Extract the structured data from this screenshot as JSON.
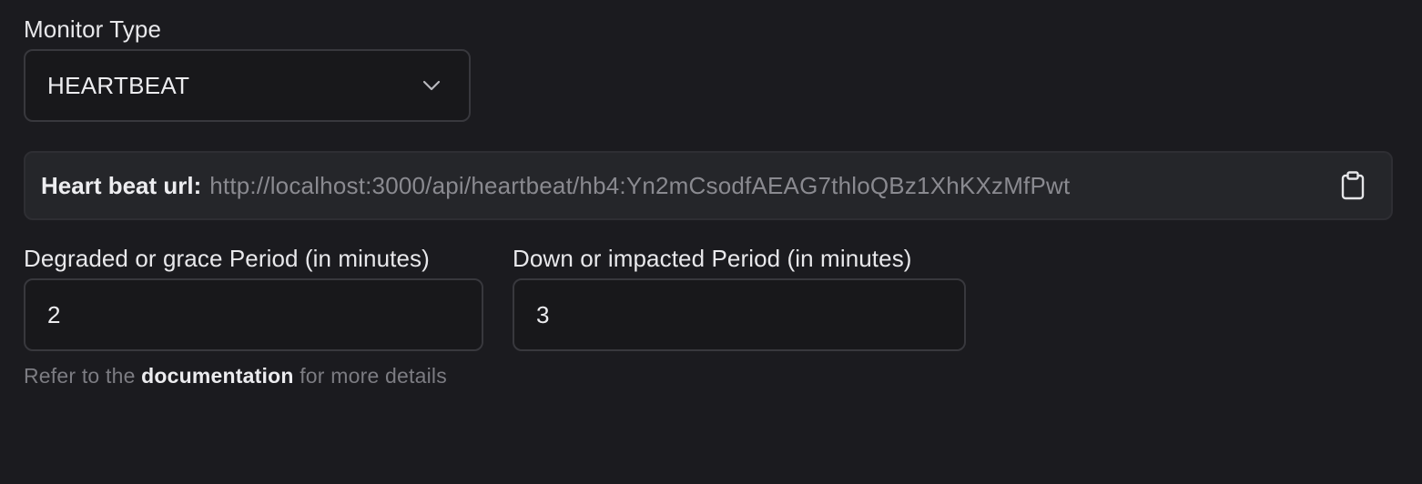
{
  "monitor_type": {
    "label": "Monitor Type",
    "selected": "HEARTBEAT",
    "chevron_icon": "chevron-down-icon"
  },
  "heartbeat": {
    "url_label": "Heart beat url:",
    "url_value": "http://localhost:3000/api/heartbeat/hb4:Yn2mCsodfAEAG7thloQBz1XhKXzMfPwt",
    "copy_icon": "clipboard-icon"
  },
  "degraded_period": {
    "label": "Degraded or grace Period (in minutes)",
    "value": "2"
  },
  "down_period": {
    "label": "Down or impacted Period (in minutes)",
    "value": "3"
  },
  "help": {
    "prefix": "Refer to the ",
    "link_text": "documentation",
    "suffix": " for more details"
  },
  "colors": {
    "background": "#1b1b1f",
    "input_background": "#18181b",
    "panel_background": "#25262a",
    "border": "#38383d",
    "muted_text": "#8a8a90"
  }
}
